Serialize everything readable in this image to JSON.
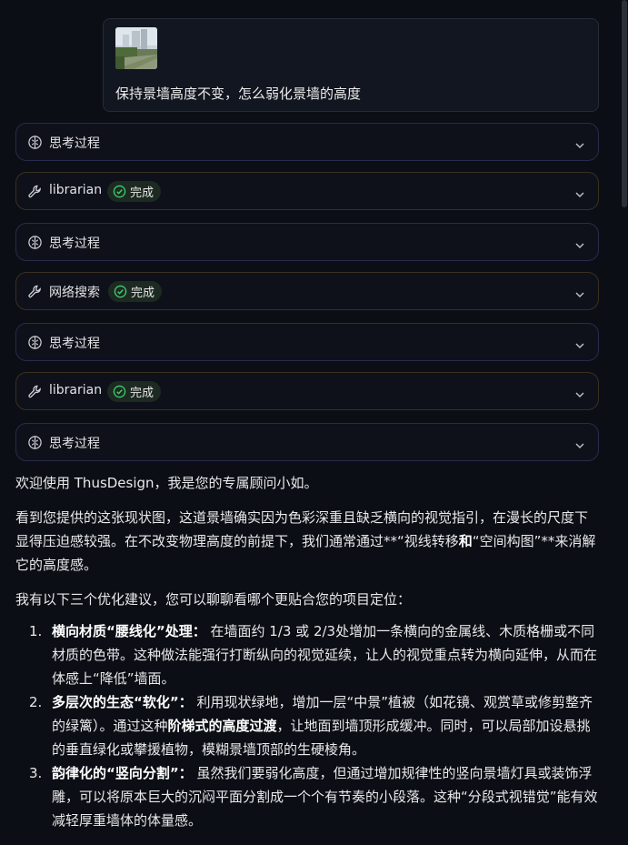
{
  "user_message": {
    "text": "保持景墙高度不变，怎么弱化景墙的高度",
    "attachment_icon": "photo-thumbnail"
  },
  "steps": [
    {
      "kind": "thinking",
      "label": "思考过程",
      "icon": "brain-icon"
    },
    {
      "kind": "tool",
      "label": "librarian",
      "status": "完成",
      "icon": "wrench-icon"
    },
    {
      "kind": "thinking",
      "label": "思考过程",
      "icon": "brain-icon"
    },
    {
      "kind": "tool",
      "label": "网络搜索",
      "status": "完成",
      "icon": "wrench-icon"
    },
    {
      "kind": "thinking",
      "label": "思考过程",
      "icon": "brain-icon"
    },
    {
      "kind": "tool",
      "label": "librarian",
      "status": "完成",
      "icon": "wrench-icon"
    },
    {
      "kind": "thinking",
      "label": "思考过程",
      "icon": "brain-icon"
    }
  ],
  "answer": {
    "greeting": "欢迎使用 ThusDesign，我是您的专属顾问小如。",
    "analysis": "看到您提供的这张现状图，这道景墙确实因为色彩深重且缺乏横向的视觉指引，在漫长的尺度下显得压迫感较强。在不改变物理高度的前提下，我们通常通过**“视线转移",
    "analysis_bold": "和",
    "analysis_end": "“空间构图”**来消解它的高度感。",
    "lead": "我有以下三个优化建议，您可以聊聊看哪个更贴合您的项目定位：",
    "items": [
      {
        "num": "1.",
        "title": "横向材质“腰线化”处理",
        "colon": "：",
        "text": " 在墙面约 1/3 或 2/3处增加一条横向的金属线、木质格栅或不同材质的色带。这种做法能强行打断纵向的视觉延续，让人的视觉重点转为横向延伸，从而在体感上“降低”墙面。"
      },
      {
        "num": "2.",
        "title": "多层次的生态“软化”",
        "colon": "：",
        "text_a": " 利用现状绿地，增加一层“中景”植被（如花镜、观赏草或修剪整齐的绿篱）。通过这种",
        "bold": "阶梯式的高度过渡",
        "text_b": "，让地面到墙顶形成缓冲。同时，可以局部加设悬挑的垂直绿化或攀援植物，模糊景墙顶部的生硬棱角。"
      },
      {
        "num": "3.",
        "title": "韵律化的“竖向分割”",
        "colon": "：",
        "text": " 虽然我们要弱化高度，但通过增加规律性的竖向景墙灯具或装饰浮雕，可以将原本巨大的沉闷平面分割成一个个有节奏的小段落。这种“分段式视错觉”能有效减轻厚重墙体的体量感。"
      }
    ]
  },
  "colors": {
    "background": "#0b0e14",
    "thinking_border": "#2a2b4c",
    "tool_border": "#3a3020",
    "success_green": "#3fcf6e"
  }
}
